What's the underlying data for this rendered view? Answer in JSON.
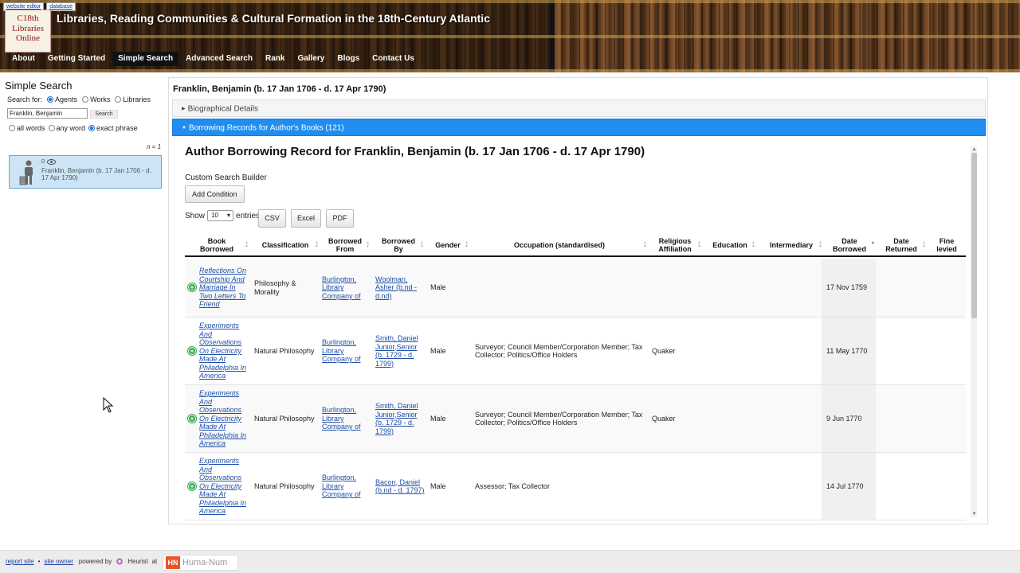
{
  "header": {
    "top_links": [
      "website editor",
      "database"
    ],
    "logo_lines": [
      "C18th",
      "Libraries",
      "Online"
    ],
    "site_title": "Libraries, Reading Communities & Cultural Formation in the 18th-Century Atlantic",
    "nav": [
      "About",
      "Getting Started",
      "Simple Search",
      "Advanced Search",
      "Rank",
      "Gallery",
      "Blogs",
      "Contact Us"
    ],
    "nav_active": "Simple Search"
  },
  "sidebar": {
    "title": "Simple Search",
    "search_for_label": "Search for:",
    "search_for_options": [
      "Agents",
      "Works",
      "Libraries"
    ],
    "search_for_selected": "Agents",
    "search_value": "Franklin, Benjamin",
    "search_button": "Search",
    "match_options": [
      "all words",
      "any word",
      "exact phrase"
    ],
    "match_selected": "exact phrase",
    "result_count": "n = 1",
    "result": {
      "count_badge": "0",
      "name": "Franklin, Benjamin (b. 17 Jan 1706 - d. 17 Apr 1790)"
    }
  },
  "main": {
    "record_title": "Franklin, Benjamin (b. 17 Jan 1706 - d. 17 Apr 1790)",
    "accordion_bio": "Biographical Details",
    "accordion_borrow": "Borrowing Records for Author's Books (121)",
    "panel_title": "Author Borrowing Record for Franklin, Benjamin (b. 17 Jan 1706 - d. 17 Apr 1790)",
    "custom_search_label": "Custom Search Builder",
    "add_condition": "Add Condition",
    "show_label": "Show",
    "show_value": "10",
    "entries_label": "entries",
    "export_buttons": [
      "CSV",
      "Excel",
      "PDF"
    ],
    "columns": [
      "Book Borrowed",
      "Classification",
      "Borrowed From",
      "Borrowed By",
      "Gender",
      "Occupation (standardised)",
      "Religious Affiliation",
      "Education",
      "Intermediary",
      "Date Borrowed",
      "Date Returned",
      "Fine levied"
    ],
    "sorted_column": "Date Borrowed",
    "rows": [
      {
        "book": "Reflections On Courtship And Marriage In Two Letters To Friend",
        "classification": "Philosophy & Morality",
        "borrowed_from": "Burlington, Library Company of",
        "borrowed_by": "Woolman, Asher (b.nd - d.nd)",
        "gender": "Male",
        "occupation": "",
        "religion": "",
        "education": "",
        "intermediary": "",
        "date_borrowed": "17 Nov 1759",
        "date_returned": "",
        "fine": ""
      },
      {
        "book": "Experiments And Observations On Electricity Made At Philadelphia In America",
        "classification": "Natural Philosophy",
        "borrowed_from": "Burlington, Library Company of",
        "borrowed_by": "Smith, Daniel Junior,Senior (b. 1729 - d. 1799)",
        "gender": "Male",
        "occupation": "Surveyor; Council Member/Corporation Member; Tax Collector; Politics/Office Holders",
        "religion": "Quaker",
        "education": "",
        "intermediary": "",
        "date_borrowed": "11 May 1770",
        "date_returned": "",
        "fine": ""
      },
      {
        "book": "Experiments And Observations On Electricity Made At Philadelphia In America",
        "classification": "Natural Philosophy",
        "borrowed_from": "Burlington, Library Company of",
        "borrowed_by": "Smith, Daniel Junior,Senior (b. 1729 - d. 1799)",
        "gender": "Male",
        "occupation": "Surveyor; Council Member/Corporation Member; Tax Collector; Politics/Office Holders",
        "religion": "Quaker",
        "education": "",
        "intermediary": "",
        "date_borrowed": "9 Jun 1770",
        "date_returned": "",
        "fine": ""
      },
      {
        "book": "Experiments And Observations On Electricity Made At Philadelphia In America",
        "classification": "Natural Philosophy",
        "borrowed_from": "Burlington, Library Company of",
        "borrowed_by": "Bacon, Daniel (b.nd - d. 1797)",
        "gender": "Male",
        "occupation": "Assessor; Tax Collector",
        "religion": "",
        "education": "",
        "intermediary": "",
        "date_borrowed": "14 Jul 1770",
        "date_returned": "",
        "fine": ""
      }
    ]
  },
  "footer": {
    "report_site": "report site",
    "site_owner": "site owner",
    "powered_by": "powered by",
    "heurist": "Heurist",
    "at": "at",
    "huma_badge": "HN",
    "huma_name": "Huma-Num"
  }
}
